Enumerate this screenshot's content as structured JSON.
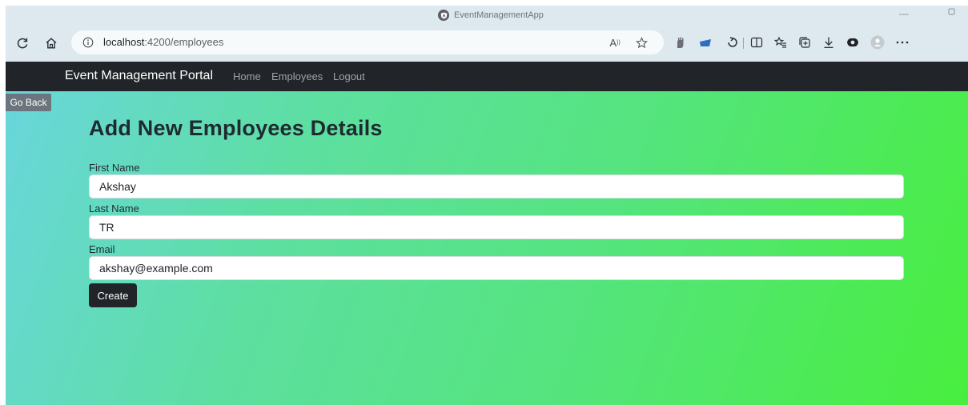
{
  "window": {
    "title": "EventManagementApp"
  },
  "browser": {
    "url_host": "localhost",
    "url_path": ":4200/employees",
    "read_aloud_label": "A"
  },
  "navbar": {
    "brand": "Event Management Portal",
    "links": [
      "Home",
      "Employees",
      "Logout"
    ]
  },
  "page": {
    "go_back_label": "Go Back",
    "heading": "Add New Employees Details",
    "form": {
      "first_name": {
        "label": "First Name",
        "value": "Akshay"
      },
      "last_name": {
        "label": "Last Name",
        "value": "TR"
      },
      "email": {
        "label": "Email",
        "value": "akshay@example.com"
      },
      "submit_label": "Create"
    }
  },
  "colors": {
    "navbar_bg": "#212529",
    "gradient_start": "#69d6dc",
    "gradient_end": "#48ee3e",
    "go_back_bg": "#6c757d",
    "create_bg": "#212529"
  }
}
